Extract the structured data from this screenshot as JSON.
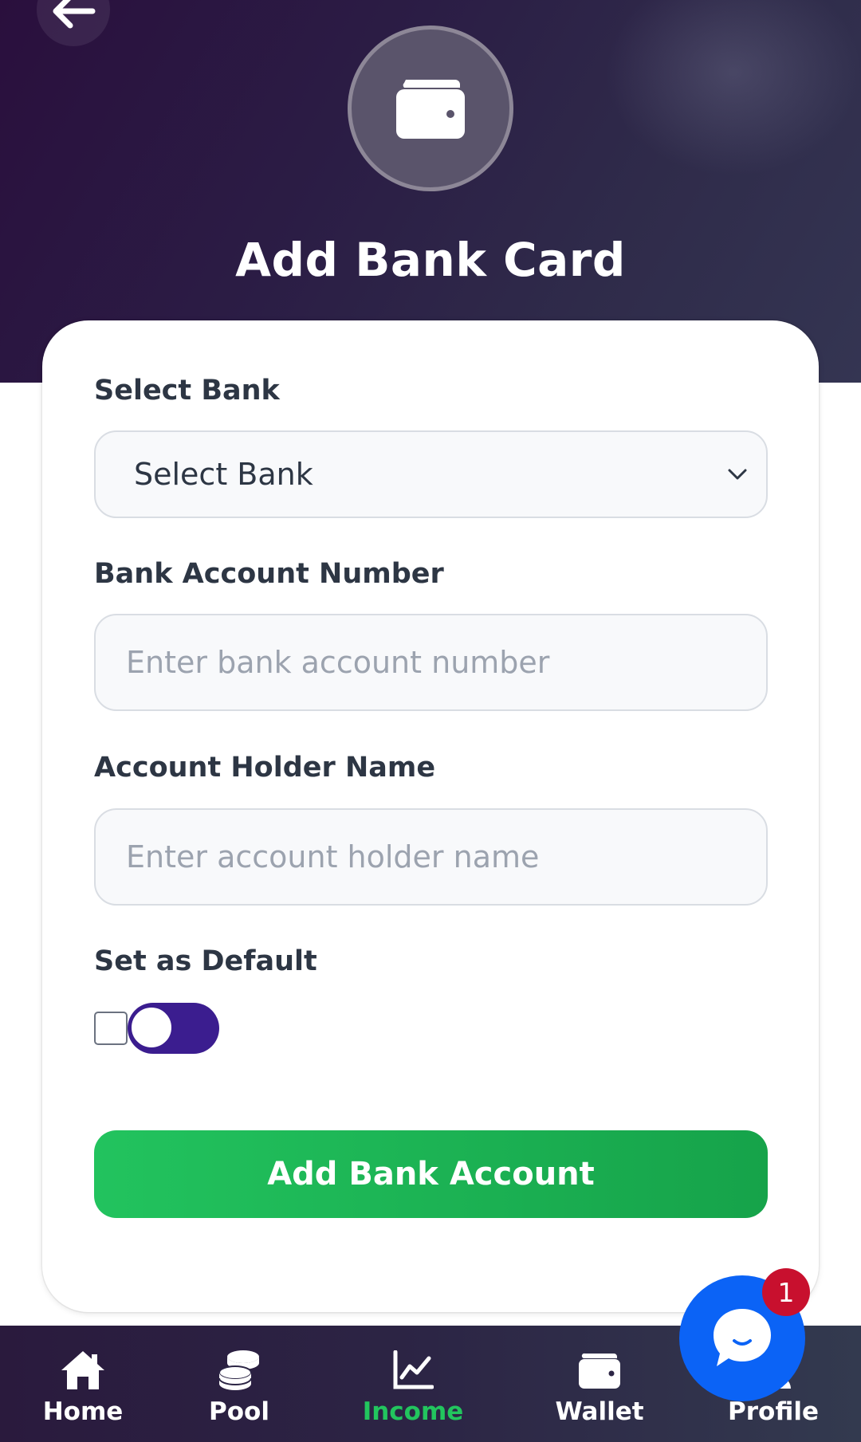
{
  "header": {
    "title": "Add Bank Card",
    "back_icon": "arrow-left-icon",
    "hero_icon": "wallet-icon"
  },
  "form": {
    "select_bank": {
      "label": "Select Bank",
      "selected_value": "Select Bank"
    },
    "account_number": {
      "label": "Bank Account Number",
      "placeholder": "Enter bank account number"
    },
    "holder_name": {
      "label": "Account Holder Name",
      "placeholder": "Enter account holder name"
    },
    "default_toggle": {
      "label": "Set as Default",
      "checked": false
    },
    "submit_label": "Add Bank Account"
  },
  "nav": {
    "items": [
      {
        "label": "Home",
        "icon": "home-icon"
      },
      {
        "label": "Pool",
        "icon": "coins-icon"
      },
      {
        "label": "Income",
        "icon": "chart-line-icon",
        "active": true
      },
      {
        "label": "Wallet",
        "icon": "wallet-icon"
      },
      {
        "label": "Profile",
        "icon": "user-icon"
      }
    ]
  },
  "chat": {
    "icon": "chat-bubble-icon",
    "badge_count": "1"
  },
  "colors": {
    "header_bg": "#2b1d45",
    "accent_green": "#22c55e",
    "toggle_purple": "#3b1d8f",
    "chat_blue": "#0b63f6",
    "badge_red": "#c8102e"
  }
}
